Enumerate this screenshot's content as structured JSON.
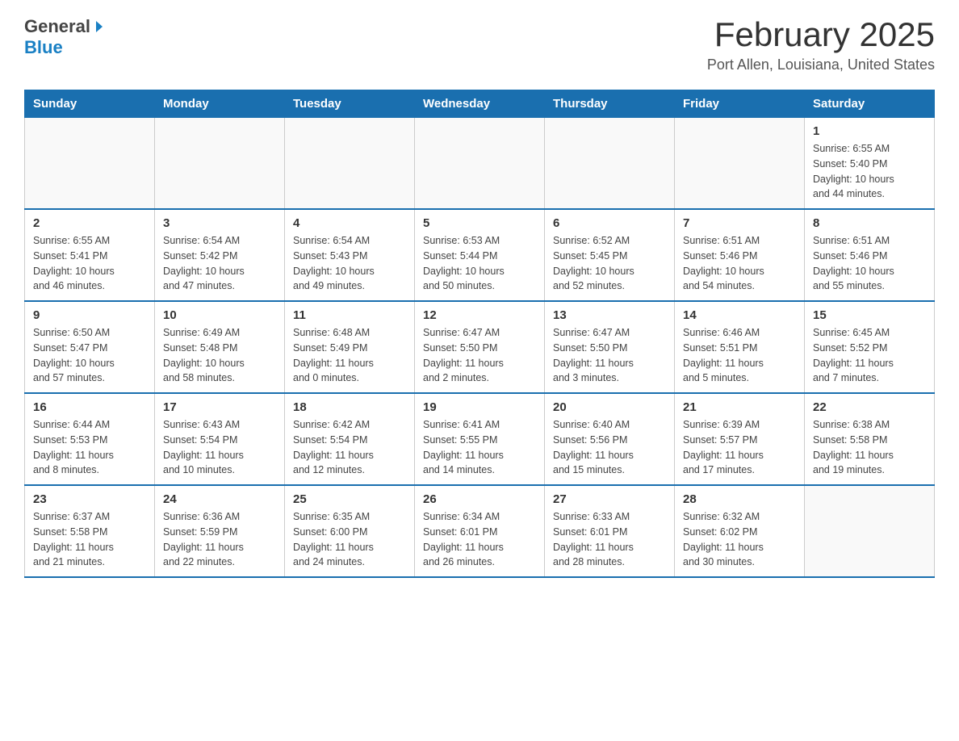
{
  "header": {
    "logo": {
      "general_text": "General",
      "blue_text": "Blue"
    },
    "title": "February 2025",
    "location": "Port Allen, Louisiana, United States"
  },
  "calendar": {
    "days_of_week": [
      "Sunday",
      "Monday",
      "Tuesday",
      "Wednesday",
      "Thursday",
      "Friday",
      "Saturday"
    ],
    "weeks": [
      {
        "days": [
          {
            "number": "",
            "info": ""
          },
          {
            "number": "",
            "info": ""
          },
          {
            "number": "",
            "info": ""
          },
          {
            "number": "",
            "info": ""
          },
          {
            "number": "",
            "info": ""
          },
          {
            "number": "",
            "info": ""
          },
          {
            "number": "1",
            "info": "Sunrise: 6:55 AM\nSunset: 5:40 PM\nDaylight: 10 hours\nand 44 minutes."
          }
        ]
      },
      {
        "days": [
          {
            "number": "2",
            "info": "Sunrise: 6:55 AM\nSunset: 5:41 PM\nDaylight: 10 hours\nand 46 minutes."
          },
          {
            "number": "3",
            "info": "Sunrise: 6:54 AM\nSunset: 5:42 PM\nDaylight: 10 hours\nand 47 minutes."
          },
          {
            "number": "4",
            "info": "Sunrise: 6:54 AM\nSunset: 5:43 PM\nDaylight: 10 hours\nand 49 minutes."
          },
          {
            "number": "5",
            "info": "Sunrise: 6:53 AM\nSunset: 5:44 PM\nDaylight: 10 hours\nand 50 minutes."
          },
          {
            "number": "6",
            "info": "Sunrise: 6:52 AM\nSunset: 5:45 PM\nDaylight: 10 hours\nand 52 minutes."
          },
          {
            "number": "7",
            "info": "Sunrise: 6:51 AM\nSunset: 5:46 PM\nDaylight: 10 hours\nand 54 minutes."
          },
          {
            "number": "8",
            "info": "Sunrise: 6:51 AM\nSunset: 5:46 PM\nDaylight: 10 hours\nand 55 minutes."
          }
        ]
      },
      {
        "days": [
          {
            "number": "9",
            "info": "Sunrise: 6:50 AM\nSunset: 5:47 PM\nDaylight: 10 hours\nand 57 minutes."
          },
          {
            "number": "10",
            "info": "Sunrise: 6:49 AM\nSunset: 5:48 PM\nDaylight: 10 hours\nand 58 minutes."
          },
          {
            "number": "11",
            "info": "Sunrise: 6:48 AM\nSunset: 5:49 PM\nDaylight: 11 hours\nand 0 minutes."
          },
          {
            "number": "12",
            "info": "Sunrise: 6:47 AM\nSunset: 5:50 PM\nDaylight: 11 hours\nand 2 minutes."
          },
          {
            "number": "13",
            "info": "Sunrise: 6:47 AM\nSunset: 5:50 PM\nDaylight: 11 hours\nand 3 minutes."
          },
          {
            "number": "14",
            "info": "Sunrise: 6:46 AM\nSunset: 5:51 PM\nDaylight: 11 hours\nand 5 minutes."
          },
          {
            "number": "15",
            "info": "Sunrise: 6:45 AM\nSunset: 5:52 PM\nDaylight: 11 hours\nand 7 minutes."
          }
        ]
      },
      {
        "days": [
          {
            "number": "16",
            "info": "Sunrise: 6:44 AM\nSunset: 5:53 PM\nDaylight: 11 hours\nand 8 minutes."
          },
          {
            "number": "17",
            "info": "Sunrise: 6:43 AM\nSunset: 5:54 PM\nDaylight: 11 hours\nand 10 minutes."
          },
          {
            "number": "18",
            "info": "Sunrise: 6:42 AM\nSunset: 5:54 PM\nDaylight: 11 hours\nand 12 minutes."
          },
          {
            "number": "19",
            "info": "Sunrise: 6:41 AM\nSunset: 5:55 PM\nDaylight: 11 hours\nand 14 minutes."
          },
          {
            "number": "20",
            "info": "Sunrise: 6:40 AM\nSunset: 5:56 PM\nDaylight: 11 hours\nand 15 minutes."
          },
          {
            "number": "21",
            "info": "Sunrise: 6:39 AM\nSunset: 5:57 PM\nDaylight: 11 hours\nand 17 minutes."
          },
          {
            "number": "22",
            "info": "Sunrise: 6:38 AM\nSunset: 5:58 PM\nDaylight: 11 hours\nand 19 minutes."
          }
        ]
      },
      {
        "days": [
          {
            "number": "23",
            "info": "Sunrise: 6:37 AM\nSunset: 5:58 PM\nDaylight: 11 hours\nand 21 minutes."
          },
          {
            "number": "24",
            "info": "Sunrise: 6:36 AM\nSunset: 5:59 PM\nDaylight: 11 hours\nand 22 minutes."
          },
          {
            "number": "25",
            "info": "Sunrise: 6:35 AM\nSunset: 6:00 PM\nDaylight: 11 hours\nand 24 minutes."
          },
          {
            "number": "26",
            "info": "Sunrise: 6:34 AM\nSunset: 6:01 PM\nDaylight: 11 hours\nand 26 minutes."
          },
          {
            "number": "27",
            "info": "Sunrise: 6:33 AM\nSunset: 6:01 PM\nDaylight: 11 hours\nand 28 minutes."
          },
          {
            "number": "28",
            "info": "Sunrise: 6:32 AM\nSunset: 6:02 PM\nDaylight: 11 hours\nand 30 minutes."
          },
          {
            "number": "",
            "info": ""
          }
        ]
      }
    ]
  }
}
